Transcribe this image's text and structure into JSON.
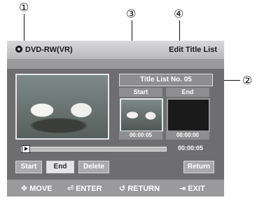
{
  "callouts": {
    "c1": "①",
    "c2": "②",
    "c3": "③",
    "c4": "④"
  },
  "header": {
    "disc": "DVD-RW(VR)",
    "screen_title": "Edit Title List"
  },
  "title_list": {
    "label": "Title List No. 05"
  },
  "thumbnails": {
    "start": {
      "label": "Start",
      "time": "00:00:05"
    },
    "end": {
      "label": "End",
      "time": "00:00:00"
    }
  },
  "playback": {
    "current_time": "00:00:05",
    "progress_fraction": 0.02
  },
  "buttons": {
    "start": "Start",
    "end": "End",
    "delete": "Delete",
    "return": "Return",
    "selected": "End"
  },
  "footer": {
    "move": {
      "icon": "dpad-icon",
      "label": "MOVE"
    },
    "enter": {
      "icon": "enter-icon",
      "label": "ENTER"
    },
    "return": {
      "icon": "return-icon",
      "label": "RETURN"
    },
    "exit": {
      "icon": "exit-icon",
      "label": "EXIT"
    }
  },
  "colors": {
    "screen_bg": "#6e6e70",
    "titlebar": "#c9c9cb",
    "highlight": "#e4e4e6"
  }
}
